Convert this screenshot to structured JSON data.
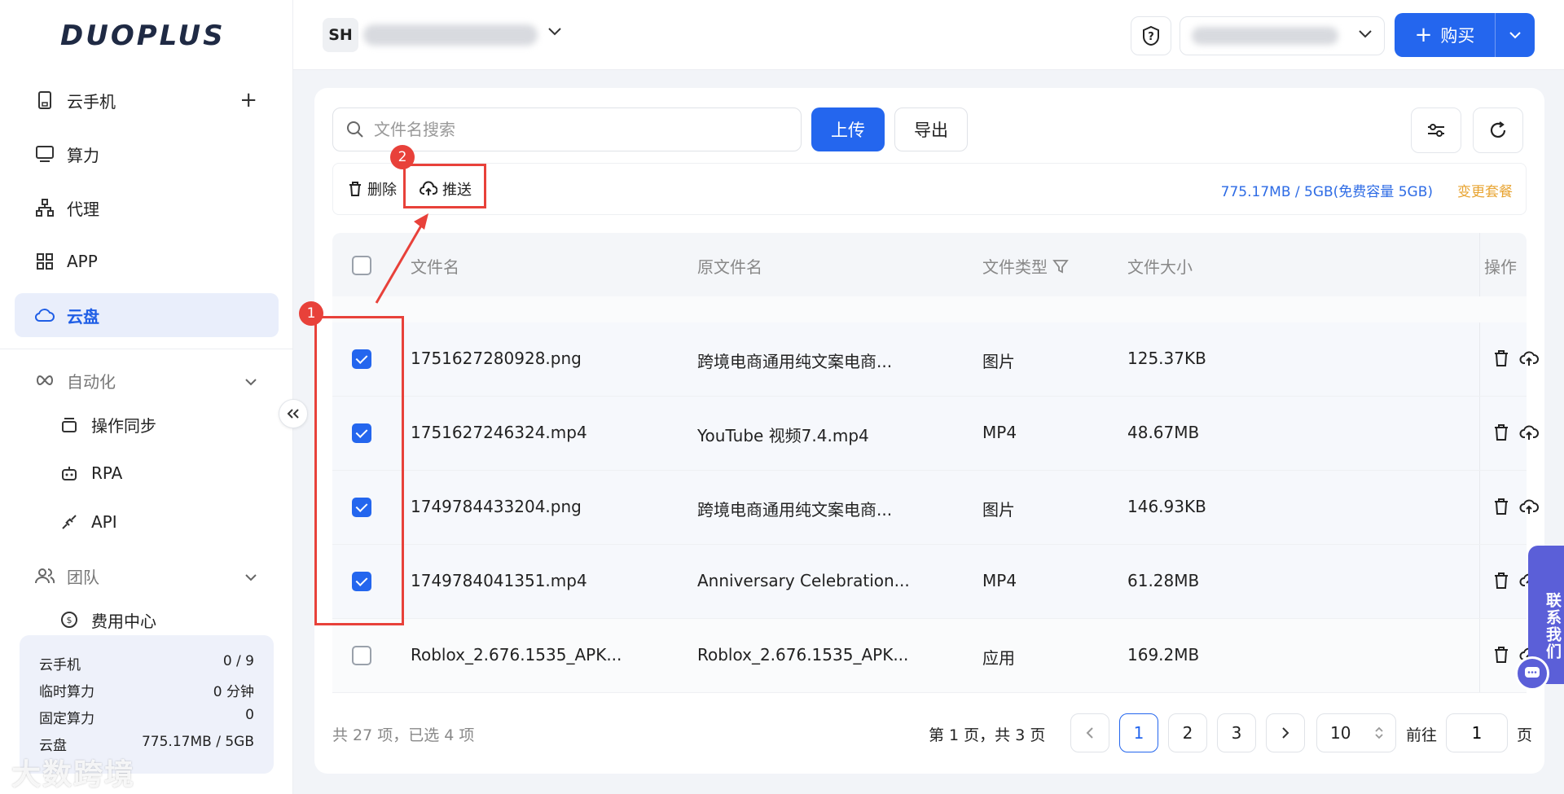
{
  "brand": {
    "logo_text": "DUOPLUS"
  },
  "sidebar": {
    "items": [
      {
        "label": "云手机",
        "icon": "phone-icon"
      },
      {
        "label": "算力",
        "icon": "monitor-icon"
      },
      {
        "label": "代理",
        "icon": "network-icon"
      },
      {
        "label": "APP",
        "icon": "apps-grid-icon"
      },
      {
        "label": "云盘",
        "icon": "cloud-icon",
        "active": true
      }
    ],
    "automation": {
      "label": "自动化",
      "children": [
        "操作同步",
        "RPA",
        "API"
      ]
    },
    "team": {
      "label": "团队",
      "children": [
        "费用中心"
      ]
    },
    "usage": [
      {
        "label": "云手机",
        "value": "0 / 9"
      },
      {
        "label": "临时算力",
        "value": "0 分钟"
      },
      {
        "label": "固定算力",
        "value": "0"
      },
      {
        "label": "云盘",
        "value": "775.17MB / 5GB"
      }
    ],
    "watermark": "大数跨境"
  },
  "header": {
    "account_badge": "SH",
    "buy_label": "购买"
  },
  "toolbar": {
    "search_placeholder": "文件名搜索",
    "upload_label": "上传",
    "export_label": "导出"
  },
  "actions": {
    "delete_label": "删除",
    "push_label": "推送",
    "quota_text": "775.17MB / 5GB(免费容量 5GB)",
    "change_plan_label": "变更套餐"
  },
  "table": {
    "columns": [
      "文件名",
      "原文件名",
      "文件类型",
      "文件大小",
      "操作"
    ],
    "rows": [
      {
        "name": "1751627280928.png",
        "original": "跨境电商通用纯文案电商...",
        "type": "图片",
        "size": "125.37KB",
        "checked": true
      },
      {
        "name": "1751627246324.mp4",
        "original": "YouTube 视频7.4.mp4",
        "type": "MP4",
        "size": "48.67MB",
        "checked": true
      },
      {
        "name": "1749784433204.png",
        "original": "跨境电商通用纯文案电商...",
        "type": "图片",
        "size": "146.93KB",
        "checked": true
      },
      {
        "name": "1749784041351.mp4",
        "original": "Anniversary Celebration...",
        "type": "MP4",
        "size": "61.28MB",
        "checked": true
      },
      {
        "name": "Roblox_2.676.1535_APK...",
        "original": "Roblox_2.676.1535_APK...",
        "type": "应用",
        "size": "169.2MB",
        "checked": false
      }
    ]
  },
  "footer": {
    "total_text": "共 27 项，已选 4 项",
    "page_info": "第 1 页，共 3 页",
    "pages": [
      "1",
      "2",
      "3"
    ],
    "current_page": "1",
    "page_size": "10",
    "goto_prefix": "前往",
    "goto_value": "1",
    "goto_suffix": "页"
  },
  "annotations": {
    "step1": "1",
    "step2": "2"
  },
  "contact": {
    "label": "联系我们"
  },
  "colors": {
    "primary": "#2466ee",
    "annotation": "#e8413a",
    "plan_link": "#e8a432"
  }
}
